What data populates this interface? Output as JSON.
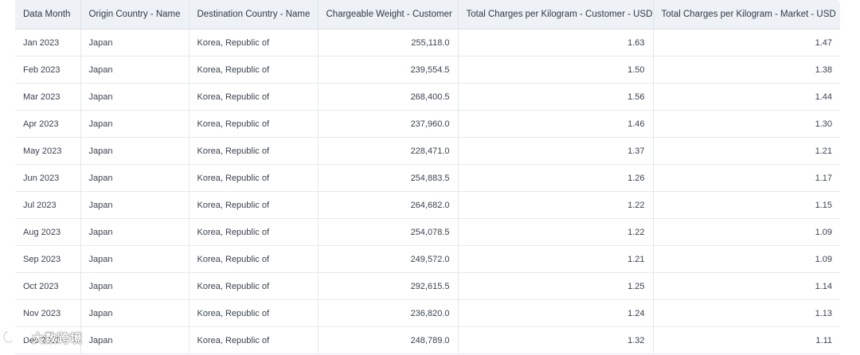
{
  "table": {
    "headers": [
      "Data Month",
      "Origin Country - Name",
      "Destination Country - Name",
      "Chargeable Weight - Customer",
      "Total Charges per Kilogram - Customer - USD",
      "Total Charges per Kilogram - Market - USD"
    ],
    "rows": [
      [
        "Jan 2023",
        "Japan",
        "Korea, Republic of",
        "255,118.0",
        "1.63",
        "1.47"
      ],
      [
        "Feb 2023",
        "Japan",
        "Korea, Republic of",
        "239,554.5",
        "1.50",
        "1.38"
      ],
      [
        "Mar 2023",
        "Japan",
        "Korea, Republic of",
        "268,400.5",
        "1.56",
        "1.44"
      ],
      [
        "Apr 2023",
        "Japan",
        "Korea, Republic of",
        "237,960.0",
        "1.46",
        "1.30"
      ],
      [
        "May 2023",
        "Japan",
        "Korea, Republic of",
        "228,471.0",
        "1.37",
        "1.21"
      ],
      [
        "Jun 2023",
        "Japan",
        "Korea, Republic of",
        "254,883.5",
        "1.26",
        "1.17"
      ],
      [
        "Jul 2023",
        "Japan",
        "Korea, Republic of",
        "264,682.0",
        "1.22",
        "1.15"
      ],
      [
        "Aug 2023",
        "Japan",
        "Korea, Republic of",
        "254,078.5",
        "1.22",
        "1.09"
      ],
      [
        "Sep 2023",
        "Japan",
        "Korea, Republic of",
        "249,572.0",
        "1.21",
        "1.09"
      ],
      [
        "Oct 2023",
        "Japan",
        "Korea, Republic of",
        "292,615.5",
        "1.25",
        "1.14"
      ],
      [
        "Nov 2023",
        "Japan",
        "Korea, Republic of",
        "236,820.0",
        "1.24",
        "1.13"
      ],
      [
        "Dec 2023",
        "Japan",
        "Korea, Republic of",
        "248,789.0",
        "1.32",
        "1.11"
      ]
    ]
  },
  "watermark": {
    "logo_text": "大数跨境",
    "logo_icon": "brand-logo-icon"
  },
  "colors": {
    "header_bg": "#eef2f7",
    "border": "#e3e7ec",
    "text": "#3b4350"
  }
}
